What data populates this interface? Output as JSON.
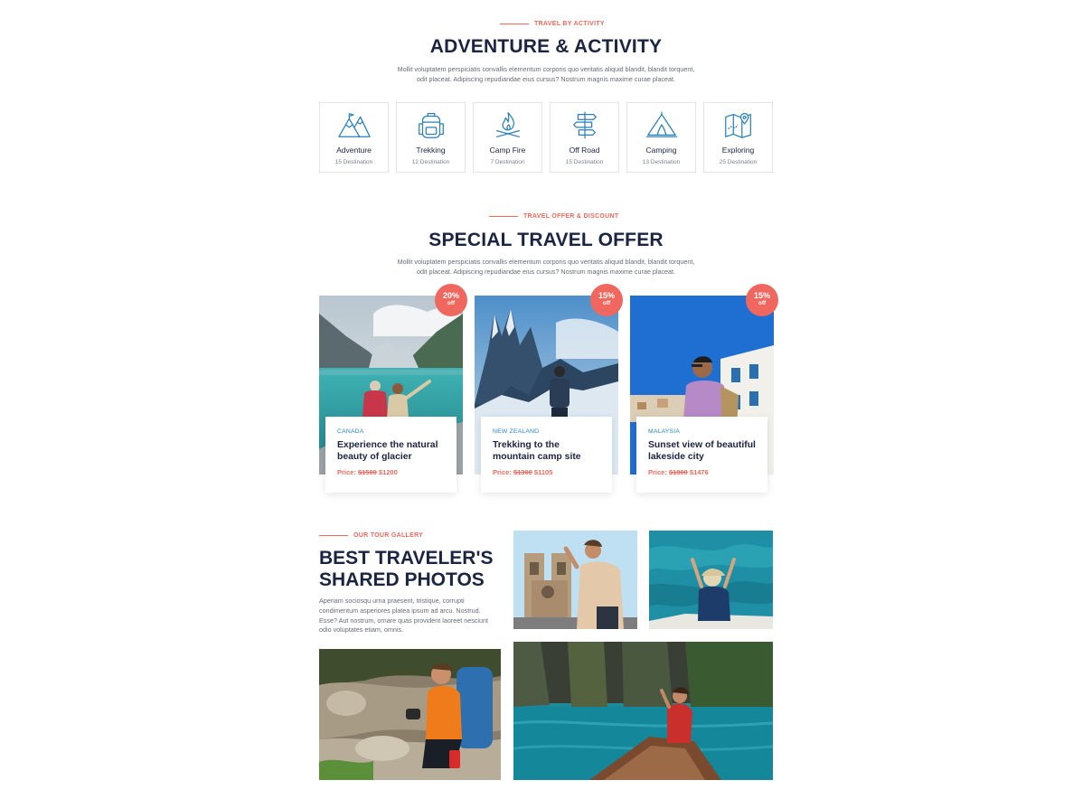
{
  "activity_section": {
    "eyebrow": "TRAVEL BY ACTIVITY",
    "title": "ADVENTURE & ACTIVITY",
    "description_line1": "Mollit voluptatem perspiciatis convallis elementum corporis quo veritatis aliquid blandit, blandit torquent,",
    "description_line2": "odit placeat. Adipiscing repudiandae eius cursus? Nostrum magnis maxime curae placeat.",
    "items": [
      {
        "name": "Adventure",
        "count": "15 Destination",
        "icon": "mountains-icon"
      },
      {
        "name": "Trekking",
        "count": "12 Destination",
        "icon": "backpack-icon"
      },
      {
        "name": "Camp Fire",
        "count": "7 Destination",
        "icon": "campfire-icon"
      },
      {
        "name": "Off Road",
        "count": "15 Destination",
        "icon": "signpost-icon"
      },
      {
        "name": "Camping",
        "count": "13 Destination",
        "icon": "tent-icon"
      },
      {
        "name": "Exploring",
        "count": "25 Destination",
        "icon": "map-icon"
      }
    ]
  },
  "offer_section": {
    "eyebrow": "TRAVEL OFFER & DISCOUNT",
    "title": "SPECIAL TRAVEL OFFER",
    "description_line1": "Mollit voluptatem perspiciatis convallis elementum corporis quo veritatis aliquid blandit, blandit torquent,",
    "description_line2": "odit placeat. Adipiscing repudiandae eius cursus? Nostrum magnis maxime curae placeat.",
    "cards": [
      {
        "discount": "20%",
        "off": "off",
        "country": "CANADA",
        "title": "Experience the natural beauty of glacier",
        "price_label": "Price:",
        "old_price": "$1500",
        "new_price": "$1200"
      },
      {
        "discount": "15%",
        "off": "off",
        "country": "NEW ZEALAND",
        "title": "Trekking to the mountain camp site",
        "price_label": "Price:",
        "old_price": "$1300",
        "new_price": "$1105"
      },
      {
        "discount": "15%",
        "off": "off",
        "country": "MALAYSIA",
        "title": "Sunset view of beautiful lakeside city",
        "price_label": "Price:",
        "old_price": "$1800",
        "new_price": "$1476"
      }
    ]
  },
  "gallery_section": {
    "eyebrow": "OUR TOUR GALLERY",
    "title_line1": "BEST TRAVELER'S",
    "title_line2": "SHARED PHOTOS",
    "description": "Aperiam sociosqu urna praesent, tristique, corrupti condimentum asperiores platea ipsum ad arcu. Nostrud. Esse? Aut nostrum, ornare quas provident laoreet nesciunt odio voluptates etiam, omnis."
  },
  "colors": {
    "accent": "#f06a5d",
    "navy": "#1b2542",
    "country_blue": "#2a86c4",
    "icon_blue": "#2b7fb8"
  }
}
